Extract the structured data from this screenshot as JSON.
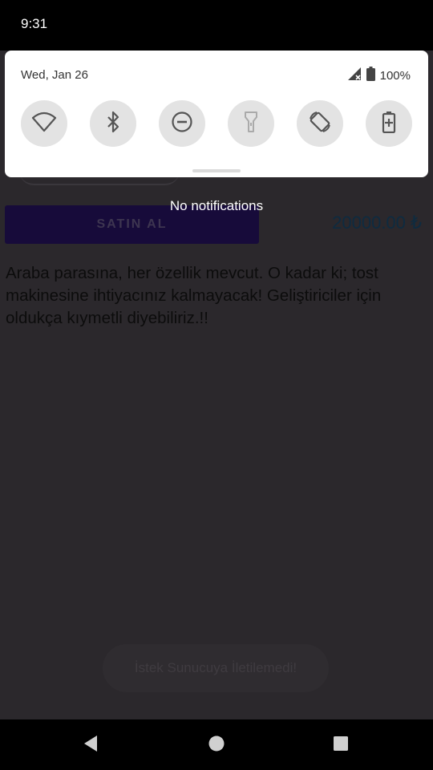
{
  "status_bar": {
    "time": "9:31"
  },
  "quick_settings": {
    "date": "Wed, Jan 26",
    "battery": "100%",
    "tiles": [
      {
        "icon": "wifi-icon",
        "label": "Wi-Fi"
      },
      {
        "icon": "bluetooth-icon",
        "label": "Bluetooth"
      },
      {
        "icon": "do-not-disturb-icon",
        "label": "Do Not Disturb"
      },
      {
        "icon": "flashlight-icon",
        "label": "Flashlight"
      },
      {
        "icon": "auto-rotate-icon",
        "label": "Auto-rotate"
      },
      {
        "icon": "battery-saver-icon",
        "label": "Battery Saver"
      }
    ]
  },
  "notifications": {
    "empty_text": "No notifications"
  },
  "product": {
    "buy_label": "SATIN AL",
    "price": "20000.00 ₺",
    "description": "Araba parasına, her özellik mevcut. O kadar ki; tost makinesine ihtiyacınız kalmayacak! Geliştiriciler için oldukça kıymetli diyebiliriz.!!"
  },
  "toast": {
    "message": "İstek Sunucuya İletilemedi!"
  },
  "colors": {
    "app_background": "#2b282c",
    "buy_button": "#170b3a",
    "price_text": "#0e2b40",
    "panel": "#ffffff",
    "tile": "#e3e3e3"
  }
}
